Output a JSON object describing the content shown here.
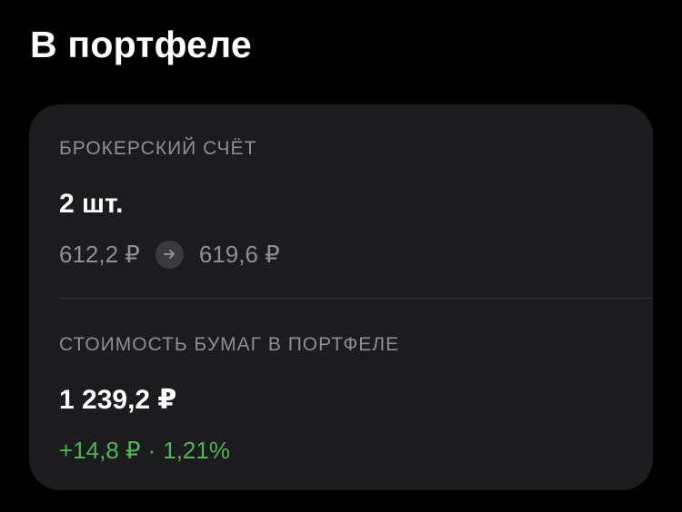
{
  "portfolio": {
    "title": "В портфеле",
    "broker": {
      "label": "БРОКЕРСКИЙ СЧЁТ",
      "quantity": "2 шт.",
      "price_from": "612,2 ₽",
      "price_to": "619,6 ₽"
    },
    "holdings": {
      "label": "СТОИМОСТЬ БУМАГ В ПОРТФЕЛЕ",
      "total": "1 239,2 ₽",
      "change_abs": "+14,8 ₽",
      "separator": "·",
      "change_pct": "1,21%"
    }
  },
  "colors": {
    "background": "#000000",
    "card": "#1c1c1e",
    "secondary_text": "#8e8e93",
    "positive": "#4cb653"
  },
  "icons": {
    "arrow": "arrow-right-icon"
  }
}
